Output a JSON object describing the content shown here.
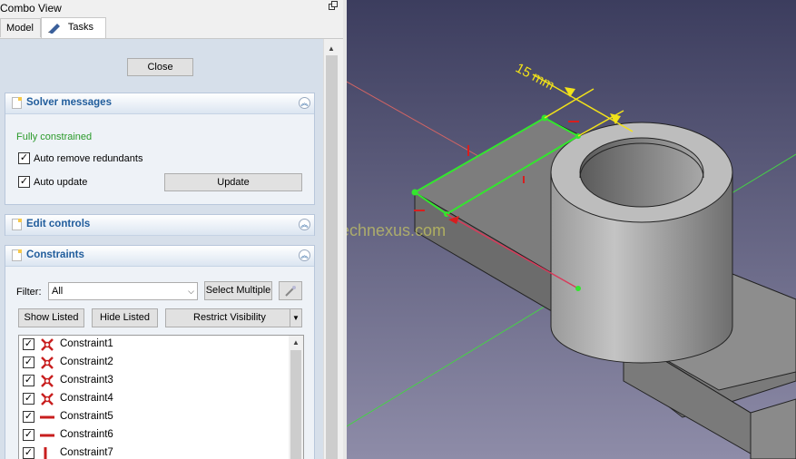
{
  "combo_view": {
    "title": "Combo View",
    "undock_icon": "undock-icon",
    "tabs": [
      {
        "label": "Model"
      },
      {
        "label": "Tasks",
        "icon": "pencil-icon"
      }
    ]
  },
  "task_panel": {
    "close_label": "Close",
    "solver_messages": {
      "title": "Solver messages",
      "status": "Fully constrained",
      "status_color": "#2a9a2a",
      "auto_remove_label": "Auto remove redundants",
      "auto_remove_checked": true,
      "auto_update_label": "Auto update",
      "auto_update_checked": true,
      "update_label": "Update"
    },
    "edit_controls": {
      "title": "Edit controls"
    },
    "constraints": {
      "title": "Constraints",
      "filter_label": "Filter:",
      "filter_value": "All",
      "select_multiple_label": "Select Multiple",
      "show_listed_label": "Show Listed",
      "hide_listed_label": "Hide Listed",
      "restrict_visibility_label": "Restrict Visibility",
      "items": [
        {
          "name": "Constraint1",
          "checked": true,
          "icon": "coincident-icon"
        },
        {
          "name": "Constraint2",
          "checked": true,
          "icon": "coincident-icon"
        },
        {
          "name": "Constraint3",
          "checked": true,
          "icon": "coincident-icon"
        },
        {
          "name": "Constraint4",
          "checked": true,
          "icon": "coincident-icon"
        },
        {
          "name": "Constraint5",
          "checked": true,
          "icon": "horizontal-icon"
        },
        {
          "name": "Constraint6",
          "checked": true,
          "icon": "horizontal-icon"
        },
        {
          "name": "Constraint7",
          "checked": true,
          "icon": "vertical-icon"
        }
      ]
    }
  },
  "viewport": {
    "dimension_label": "15 mm",
    "watermark": "technexus.com",
    "colors": {
      "background_top": "#3c3d5e",
      "background_bottom": "#8e8ca8",
      "sketch": "#33e62e",
      "dimension": "#f2e219",
      "constraint_marks": "#d81e1e"
    }
  }
}
